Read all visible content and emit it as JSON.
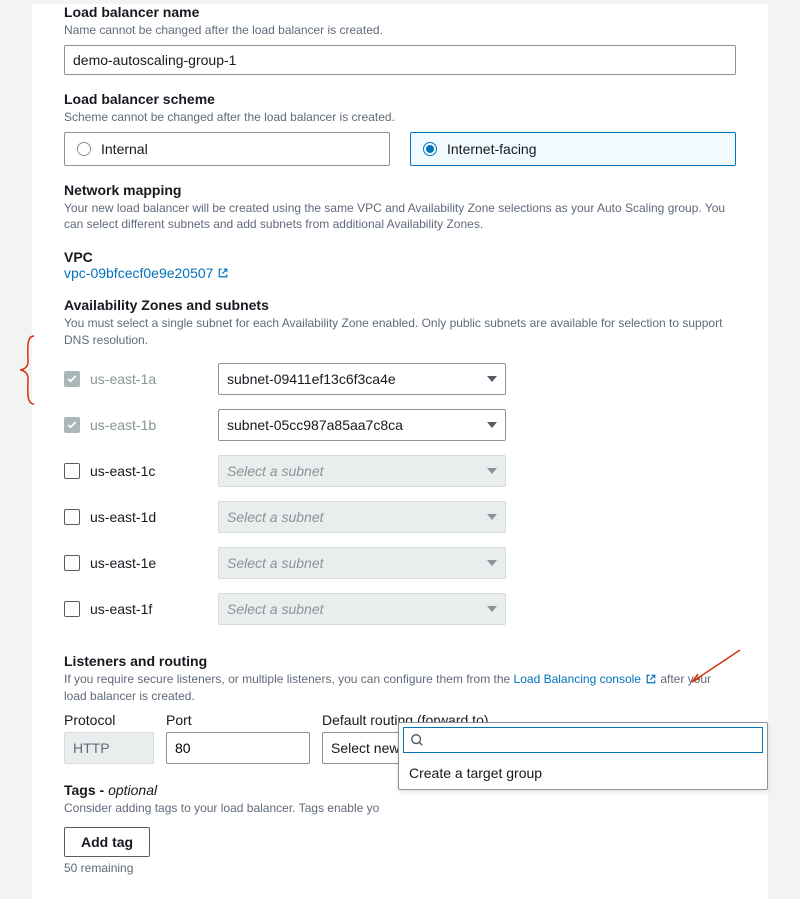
{
  "lbName": {
    "label": "Load balancer name",
    "hint": "Name cannot be changed after the load balancer is created.",
    "value": "demo-autoscaling-group-1"
  },
  "scheme": {
    "label": "Load balancer scheme",
    "hint": "Scheme cannot be changed after the load balancer is created.",
    "options": {
      "internal": "Internal",
      "internet": "Internet-facing"
    },
    "selected": "internet"
  },
  "network": {
    "label": "Network mapping",
    "hint": "Your new load balancer will be created using the same VPC and Availability Zone selections as your Auto Scaling group. You can select different subnets and add subnets from additional Availability Zones."
  },
  "vpc": {
    "label": "VPC",
    "linkText": "vpc-09bfcecf0e9e20507"
  },
  "azs": {
    "label": "Availability Zones and subnets",
    "hint": "You must select a single subnet for each Availability Zone enabled. Only public subnets are available for selection to support DNS resolution.",
    "placeholder": "Select a subnet",
    "rows": [
      {
        "name": "us-east-1a",
        "locked": true,
        "subnet": "subnet-09411ef13c6f3ca4e"
      },
      {
        "name": "us-east-1b",
        "locked": true,
        "subnet": "subnet-05cc987a85aa7c8ca"
      },
      {
        "name": "us-east-1c",
        "locked": false,
        "subnet": ""
      },
      {
        "name": "us-east-1d",
        "locked": false,
        "subnet": ""
      },
      {
        "name": "us-east-1e",
        "locked": false,
        "subnet": ""
      },
      {
        "name": "us-east-1f",
        "locked": false,
        "subnet": ""
      }
    ]
  },
  "listeners": {
    "label": "Listeners and routing",
    "hintPrefix": "If you require secure listeners, or multiple listeners, you can configure them from the ",
    "hintLink": "Load Balancing console",
    "hintSuffix": " after your load balancer is created.",
    "protocolLabel": "Protocol",
    "protocolValue": "HTTP",
    "portLabel": "Port",
    "portValue": "80",
    "routingLabel": "Default routing (forward to)",
    "routingPlaceholder": "Select new or existing target group",
    "dropdownOption": "Create a target group"
  },
  "tags": {
    "label": "Tags - ",
    "optional": "optional",
    "hint": "Consider adding tags to your load balancer. Tags enable yo",
    "addButton": "Add tag",
    "remaining": "50 remaining"
  }
}
